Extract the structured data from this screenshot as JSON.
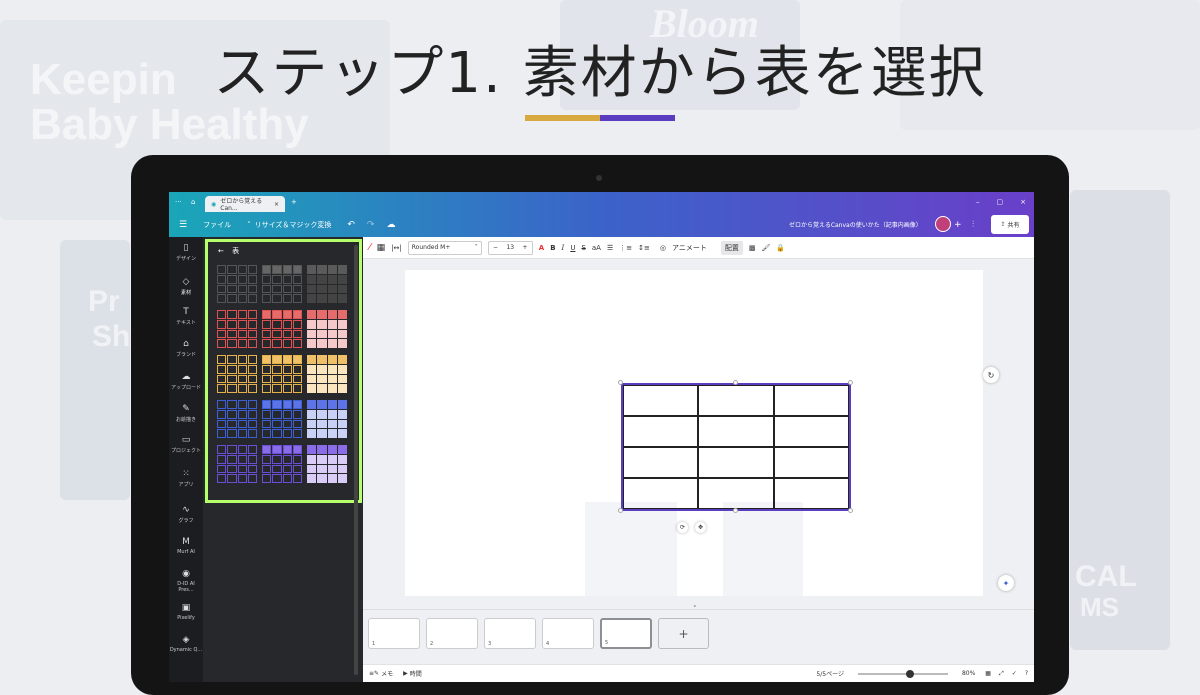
{
  "headline": "ステップ1.  素材から表を選択",
  "colors": {
    "underline_left": "#d8a93f",
    "underline_right": "#5a3cc0",
    "panel_highlight": "#b4ff6a",
    "table_border": "#5b3dc1"
  },
  "background_words": [
    "Keepin",
    "Baby Healthy",
    "Bloom",
    "Pr",
    "Sh",
    "CAL",
    "MS"
  ],
  "window": {
    "tab_title": "ゼロから覚えるCan...",
    "menu_file": "ファイル",
    "menu_resize": "リサイズ＆マジック変換",
    "doc_title": "ゼロから覚えるCanvaの使いかた（記事内画像）",
    "share": "共有"
  },
  "rail": [
    {
      "label": "デザイン",
      "icon": "layout-icon"
    },
    {
      "label": "素材",
      "icon": "elements-icon"
    },
    {
      "label": "テキスト",
      "icon": "text-icon"
    },
    {
      "label": "ブランド",
      "icon": "brand-icon"
    },
    {
      "label": "アップロード",
      "icon": "upload-icon"
    },
    {
      "label": "お絵描き",
      "icon": "draw-icon"
    },
    {
      "label": "プロジェクト",
      "icon": "folder-icon"
    },
    {
      "label": "アプリ",
      "icon": "apps-icon"
    },
    {
      "label": "グラフ",
      "icon": "chart-icon"
    },
    {
      "label": "Murf AI",
      "icon": "murf-icon"
    },
    {
      "label": "D-ID AI Pres...",
      "icon": "did-icon"
    },
    {
      "label": "Pixelify",
      "icon": "pixelify-icon"
    },
    {
      "label": "Dynamic Q...",
      "icon": "dynamic-icon"
    }
  ],
  "panel": {
    "title": "表",
    "tables": [
      {
        "color": "#555555",
        "header": "#666666"
      },
      {
        "color": "#e05252",
        "header": "#e66b6b"
      },
      {
        "color": "#e8b24a",
        "header": "#f0c267"
      },
      {
        "color": "#3d5fd6",
        "header": "#5c74e8"
      },
      {
        "color": "#6a4fd6",
        "header": "#8b6ce8"
      }
    ],
    "tints": [
      {
        "dark": "#5a5a5a",
        "light": "#444444"
      },
      {
        "dark": "#e66b6b",
        "light": "#f5c9c9"
      },
      {
        "dark": "#efc067",
        "light": "#fae5bf"
      },
      {
        "dark": "#5c74e8",
        "light": "#c9d1f7"
      },
      {
        "dark": "#8b6ce8",
        "light": "#d9ccf6"
      }
    ]
  },
  "toolbar": {
    "font": "Rounded M+",
    "size": "13",
    "bold": "B",
    "italic": "I",
    "underline": "U",
    "strike": "S",
    "case": "aA",
    "animate": "アニメート",
    "arrange": "配置"
  },
  "pages": [
    {
      "n": "1"
    },
    {
      "n": "2"
    },
    {
      "n": "3"
    },
    {
      "n": "4"
    },
    {
      "n": "5"
    }
  ],
  "status": {
    "notes": "メモ",
    "timer": "時間",
    "page_count": "5/5ページ",
    "zoom": "80%"
  }
}
